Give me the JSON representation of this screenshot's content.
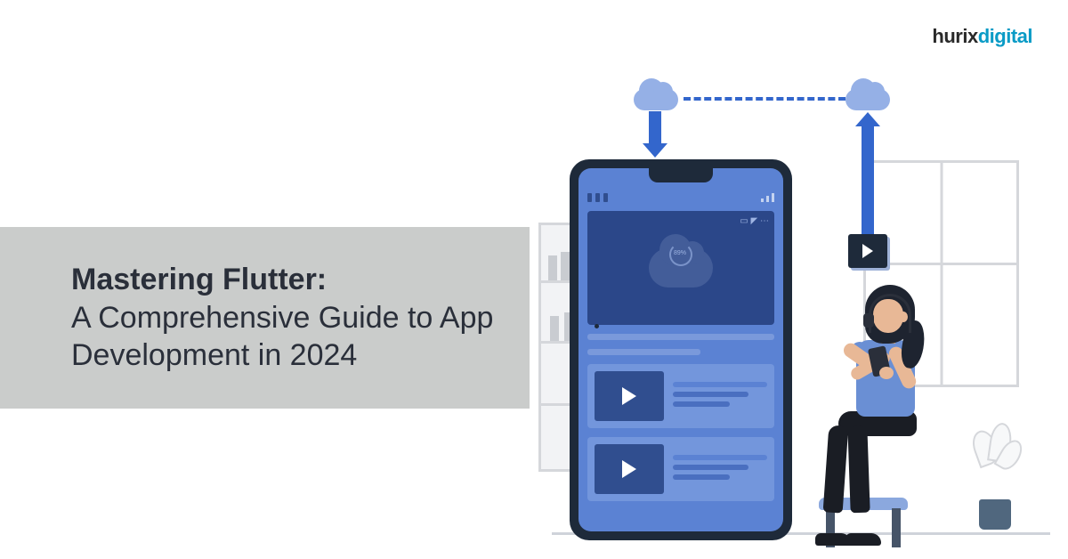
{
  "logo": {
    "part1": "hurix",
    "part2": "digital"
  },
  "title": {
    "bold": "Mastering Flutter:",
    "regular": "A Comprehensive Guide to App Development in 2024"
  },
  "illustration": {
    "upload_percent": "89%"
  }
}
